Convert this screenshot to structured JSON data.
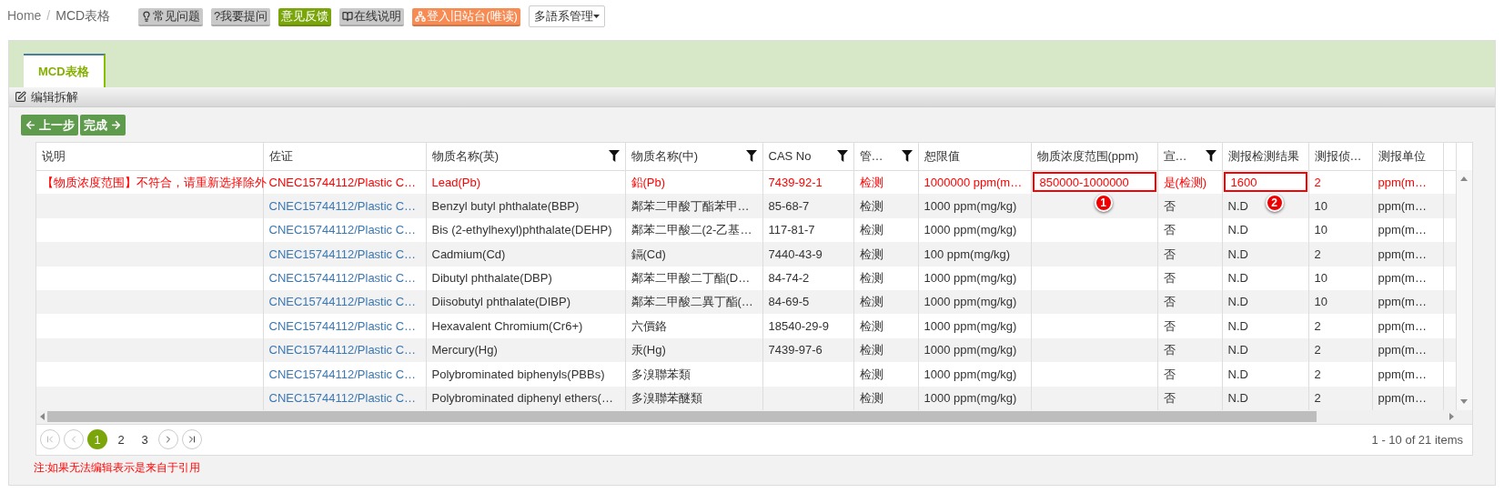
{
  "breadcrumb": {
    "separator": "/",
    "items": [
      {
        "label": "Home",
        "kind": "link"
      },
      {
        "label": "MCD表格",
        "kind": "current"
      }
    ]
  },
  "toolbar": [
    {
      "label": "常见问题",
      "color": "#c9c9c9",
      "kind": "button"
    },
    {
      "label": "?我要提问",
      "color": "#c9c9c9",
      "kind": "button"
    },
    {
      "label": "意见反馈",
      "color": "#7aa60c",
      "kind": "button"
    },
    {
      "label": "在线说明",
      "color": "#c9c9c9",
      "kind": "button"
    },
    {
      "label": "登入旧站台(唯读)",
      "color": "#f78b54",
      "kind": "button"
    },
    {
      "label": "多語系管理",
      "color": "#ffffff",
      "kind": "dropdown"
    }
  ],
  "tabs": [
    {
      "label": "MCD表格",
      "selected": true
    }
  ],
  "panel": {
    "title": "编辑拆解"
  },
  "actions": [
    {
      "label": "上一步",
      "kind": "back"
    },
    {
      "label": "完成",
      "kind": "next"
    }
  ],
  "table": {
    "columns": [
      {
        "label": "说明",
        "filter": false,
        "kind": "text"
      },
      {
        "label": "佐证",
        "filter": false,
        "kind": "link"
      },
      {
        "label": "物质名称(英)",
        "filter": true,
        "kind": "text"
      },
      {
        "label": "物质名称(中)",
        "filter": true,
        "kind": "text"
      },
      {
        "label": "CAS No",
        "filter": true,
        "kind": "text"
      },
      {
        "label": "管…",
        "filter": true,
        "kind": "text"
      },
      {
        "label": "恕限值",
        "filter": false,
        "kind": "text"
      },
      {
        "label": "物质浓度范围(ppm)",
        "filter": false,
        "kind": "text"
      },
      {
        "label": "宣…",
        "filter": true,
        "kind": "text"
      },
      {
        "label": "测报检测结果",
        "filter": false,
        "kind": "text"
      },
      {
        "label": "测报侦…",
        "filter": false,
        "kind": "text"
      },
      {
        "label": "测报单位",
        "filter": false,
        "kind": "text"
      }
    ],
    "rows": [
      {
        "invalid": true,
        "cells": [
          "【物质浓度范围】不符合，请重新选择除外",
          "CNEC15744112/Plastic C…",
          "Lead(Pb)",
          "鉛(Pb)",
          "7439-92-1",
          "检测",
          "1000000 ppm(m…",
          {
            "text": "850000-1000000",
            "flagged": true,
            "badge": "1"
          },
          "是(检测)",
          {
            "text": "1600",
            "flagged": true,
            "badge": "2"
          },
          "2",
          "ppm(m…"
        ]
      },
      {
        "invalid": false,
        "cells": [
          "",
          "CNEC15744112/Plastic C…",
          "Benzyl butyl phthalate(BBP)",
          "鄰苯二甲酸丁酯苯甲…",
          "85-68-7",
          "检测",
          "1000 ppm(mg/kg)",
          "",
          "否",
          "N.D",
          "10",
          "ppm(m…"
        ]
      },
      {
        "invalid": false,
        "cells": [
          "",
          "CNEC15744112/Plastic C…",
          "Bis (2-ethylhexyl)phthalate(DEHP)",
          "鄰苯二甲酸二(2-乙基…",
          "117-81-7",
          "检测",
          "1000 ppm(mg/kg)",
          "",
          "否",
          "N.D",
          "10",
          "ppm(m…"
        ]
      },
      {
        "invalid": false,
        "cells": [
          "",
          "CNEC15744112/Plastic C…",
          "Cadmium(Cd)",
          "鎘(Cd)",
          "7440-43-9",
          "检测",
          "100 ppm(mg/kg)",
          "",
          "否",
          "N.D",
          "2",
          "ppm(m…"
        ]
      },
      {
        "invalid": false,
        "cells": [
          "",
          "CNEC15744112/Plastic C…",
          "Dibutyl phthalate(DBP)",
          "鄰苯二甲酸二丁酯(D…",
          "84-74-2",
          "检测",
          "1000 ppm(mg/kg)",
          "",
          "否",
          "N.D",
          "10",
          "ppm(m…"
        ]
      },
      {
        "invalid": false,
        "cells": [
          "",
          "CNEC15744112/Plastic C…",
          "Diisobutyl phthalate(DIBP)",
          "鄰苯二甲酸二異丁酯(…",
          "84-69-5",
          "检测",
          "1000 ppm(mg/kg)",
          "",
          "否",
          "N.D",
          "10",
          "ppm(m…"
        ]
      },
      {
        "invalid": false,
        "cells": [
          "",
          "CNEC15744112/Plastic C…",
          "Hexavalent Chromium(Cr6+)",
          "六價鉻",
          "18540-29-9",
          "检测",
          "1000 ppm(mg/kg)",
          "",
          "否",
          "N.D",
          "2",
          "ppm(m…"
        ]
      },
      {
        "invalid": false,
        "cells": [
          "",
          "CNEC15744112/Plastic C…",
          "Mercury(Hg)",
          "汞(Hg)",
          "7439-97-6",
          "检测",
          "1000 ppm(mg/kg)",
          "",
          "否",
          "N.D",
          "2",
          "ppm(m…"
        ]
      },
      {
        "invalid": false,
        "cells": [
          "",
          "CNEC15744112/Plastic C…",
          "Polybrominated biphenyls(PBBs)",
          "多溴聯苯類",
          "",
          "检测",
          "1000 ppm(mg/kg)",
          "",
          "否",
          "N.D",
          "2",
          "ppm(m…"
        ]
      },
      {
        "invalid": false,
        "cells": [
          "",
          "CNEC15744112/Plastic C…",
          "Polybrominated diphenyl ethers(…",
          "多溴聯苯醚類",
          "",
          "检测",
          "1000 ppm(mg/kg)",
          "",
          "否",
          "N.D",
          "2",
          "ppm(m…"
        ]
      }
    ]
  },
  "pager": {
    "pages": [
      {
        "label": "1",
        "selected": true
      },
      {
        "label": "2",
        "selected": false
      },
      {
        "label": "3",
        "selected": false
      }
    ],
    "summary": "1 - 10 of 21 items"
  },
  "note": "注:如果无法编辑表示是来自于引用"
}
